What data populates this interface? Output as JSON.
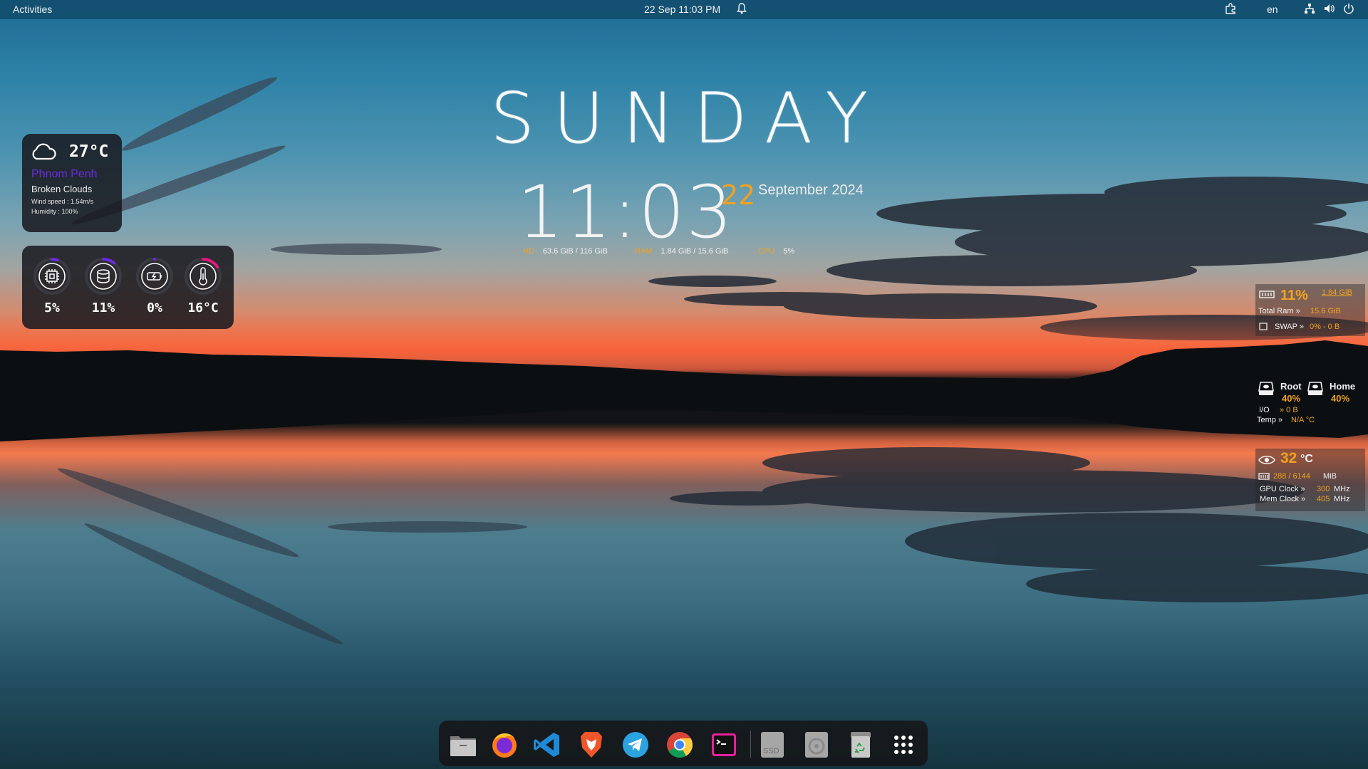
{
  "topbar": {
    "activities": "Activities",
    "clock": "22 Sep  11:03 PM",
    "language": "en",
    "icons": [
      "bell-icon",
      "extensions-icon",
      "network-icon",
      "volume-icon",
      "power-icon"
    ]
  },
  "desktop_clock": {
    "day": "SUNDAY",
    "time": "11:03",
    "date_day": "22",
    "date_rest": "September 2024",
    "hd_label": "HD",
    "hd_value": "63.6 GiB / 116 GiB",
    "ram_label": "RAM",
    "ram_value": "1.84 GiB / 15.6 GiB",
    "cpu_label": "CPU",
    "cpu_value": "5%"
  },
  "weather": {
    "temp": "27°C",
    "city": "Phnom Penh",
    "condition": "Broken Clouds",
    "wind": "Wind speed : 1.54m/s",
    "humidity": "Humidity : 100%"
  },
  "gauges": [
    {
      "icon": "cpu-icon",
      "value": "5%",
      "level": 0.05,
      "color": "#6c2be0"
    },
    {
      "icon": "database-icon",
      "value": "11%",
      "level": 0.11,
      "color": "#6c2be0"
    },
    {
      "icon": "battery-icon",
      "value": "0%",
      "level": 0.0,
      "color": "#6c2be0"
    },
    {
      "icon": "thermometer-icon",
      "value": "16°C",
      "level": 0.16,
      "color": "#e6187c"
    }
  ],
  "ram_panel": {
    "percent": "11%",
    "used": "1.84 GiB",
    "total_label": "Total Ram »",
    "total_value": "15.6 GiB",
    "swap_label": "SWAP »",
    "swap_value": "0%  -  0 B"
  },
  "disk_panel": {
    "root_label": "Root",
    "root_value": "40%",
    "home_label": "Home",
    "home_value": "40%",
    "io_label": "I/O",
    "io_value": "»  0 B",
    "temp_label": "Temp »",
    "temp_value": "N/A °C"
  },
  "gpu_panel": {
    "temp": "32",
    "temp_unit": "°C",
    "mem_value": "288 / 6144",
    "mem_unit": "MiB",
    "gpu_clock_label": "GPU Clock   »",
    "gpu_clock_value": "300",
    "mem_clock_label": "Mem Clock »",
    "mem_clock_value": "405",
    "mhz": "MHz"
  },
  "dock": {
    "ssd_label": "SSD",
    "apps": [
      "files-icon",
      "firefox-icon",
      "vscode-icon",
      "brave-icon",
      "telegram-icon",
      "chrome-icon",
      "terminal-icon",
      "ssd-drive-icon",
      "disk-icon",
      "trash-icon",
      "app-grid-icon"
    ]
  }
}
